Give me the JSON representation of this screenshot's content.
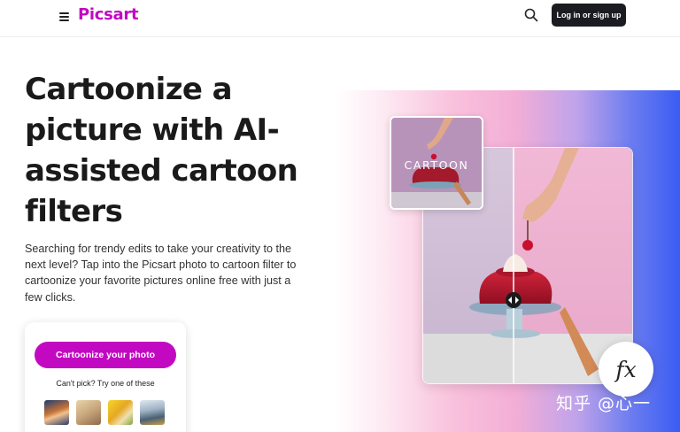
{
  "header": {
    "logo": "Picsart",
    "login_label": "Log in or sign up"
  },
  "hero": {
    "title": "Cartoonize a picture with AI-assisted cartoon filters",
    "description": "Searching for trendy edits to take your creativity to the next level? Tap into the Picsart photo to cartoon filter to cartoonize your favorite pictures online free with just a few clicks."
  },
  "cta": {
    "button_label": "Cartoonize your photo",
    "subtitle": "Can't pick? Try one of these",
    "thumbnails": [
      "sample-photo-1",
      "sample-photo-2",
      "sample-photo-3",
      "sample-photo-4"
    ]
  },
  "visual": {
    "cartoon_label": "CARTOON",
    "fx_label": "fx",
    "watermark": "知乎 @心一"
  },
  "icons": {
    "menu": "menu-icon",
    "search": "search-icon",
    "compare": "compare-slider-icon"
  },
  "colors": {
    "brand": "#c209c1",
    "login_bg": "#1b1b22"
  }
}
